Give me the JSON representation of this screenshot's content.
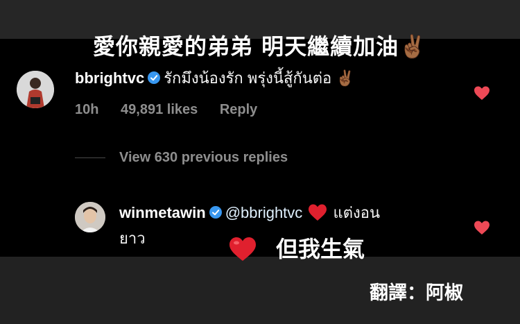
{
  "overlay": {
    "top_caption": "愛你親愛的弟弟  明天繼續加油✌🏾",
    "bottom_caption": "但我生氣",
    "translator_credit": "翻譯：阿椒"
  },
  "comments": [
    {
      "username": "bbrightvc",
      "text": "รักมึงน้องรัก พรุ่งนี้สู้กันต่อ ✌🏾",
      "time": "10h",
      "likes": "49,891 likes",
      "reply_label": "Reply"
    },
    {
      "username": "winmetawin",
      "mention": "@bbrightvc",
      "text_after_heart": "แต่งอน",
      "text_line2": "ยาว"
    }
  ],
  "view_replies_label": "View 630 previous replies",
  "colors": {
    "like_heart": "#ed4956",
    "verified_badge": "#3897f0",
    "meta_gray": "#8e8e8e",
    "overlay_bar": "#262626"
  }
}
